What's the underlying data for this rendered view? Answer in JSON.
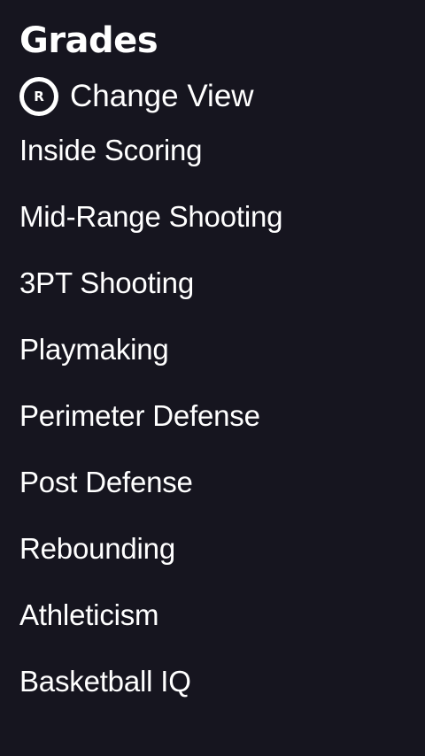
{
  "header": {
    "title": "Grades"
  },
  "change_view": {
    "button_glyph": "R",
    "icon": "r-button-icon",
    "label": "Change View"
  },
  "menu": {
    "items": [
      {
        "label": "Inside Scoring"
      },
      {
        "label": "Mid-Range Shooting"
      },
      {
        "label": "3PT Shooting"
      },
      {
        "label": "Playmaking"
      },
      {
        "label": "Perimeter Defense"
      },
      {
        "label": "Post Defense"
      },
      {
        "label": "Rebounding"
      },
      {
        "label": "Athleticism"
      },
      {
        "label": "Basketball IQ"
      }
    ]
  },
  "colors": {
    "background": "#16151f",
    "text": "#ffffff"
  }
}
